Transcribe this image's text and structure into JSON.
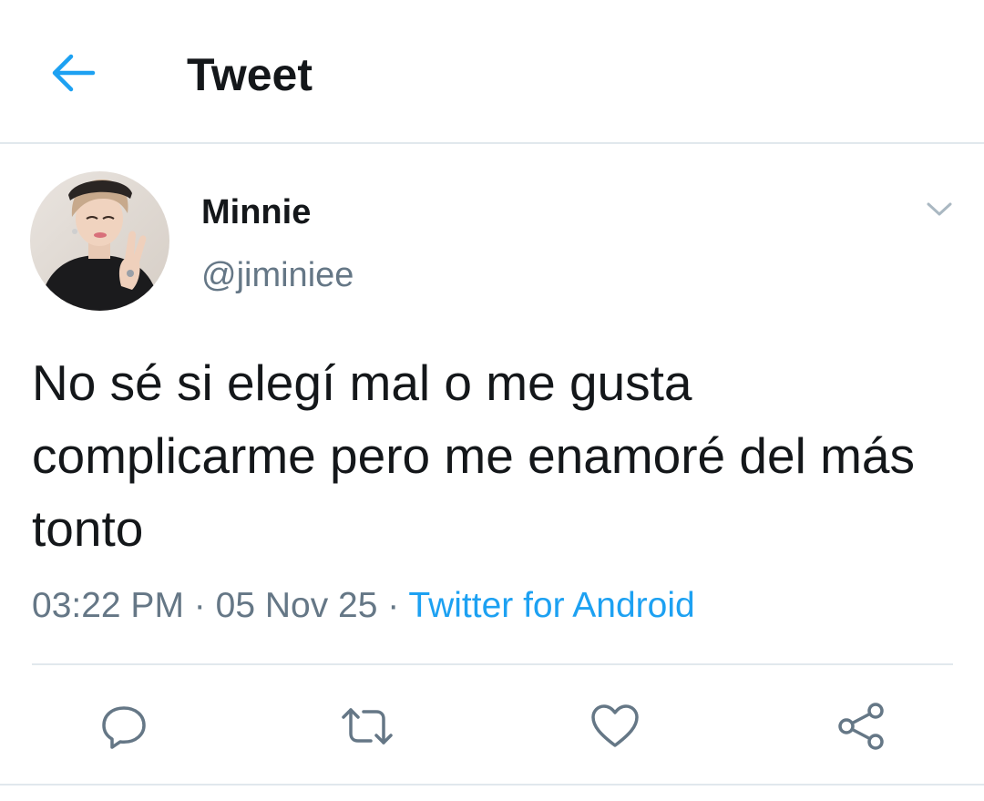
{
  "header": {
    "title": "Tweet",
    "back_icon": "arrow-left-icon",
    "accent_color": "#1da1f2"
  },
  "tweet": {
    "author": {
      "display_name": "Minnie",
      "handle": "@jiminiee",
      "avatar": "avatar-photo"
    },
    "text": "No sé si elegí mal o me gusta complicarme pero me enamoré del más tonto",
    "time": "03:22 PM",
    "separator": "·",
    "date": "05 Nov 25",
    "source": "Twitter for Android"
  },
  "actions": {
    "reply_icon": "reply-icon",
    "retweet_icon": "retweet-icon",
    "like_icon": "heart-icon",
    "share_icon": "share-icon"
  },
  "colors": {
    "text_primary": "#14171a",
    "text_secondary": "#657786",
    "link": "#1da1f2",
    "border": "#e1e8ed"
  }
}
